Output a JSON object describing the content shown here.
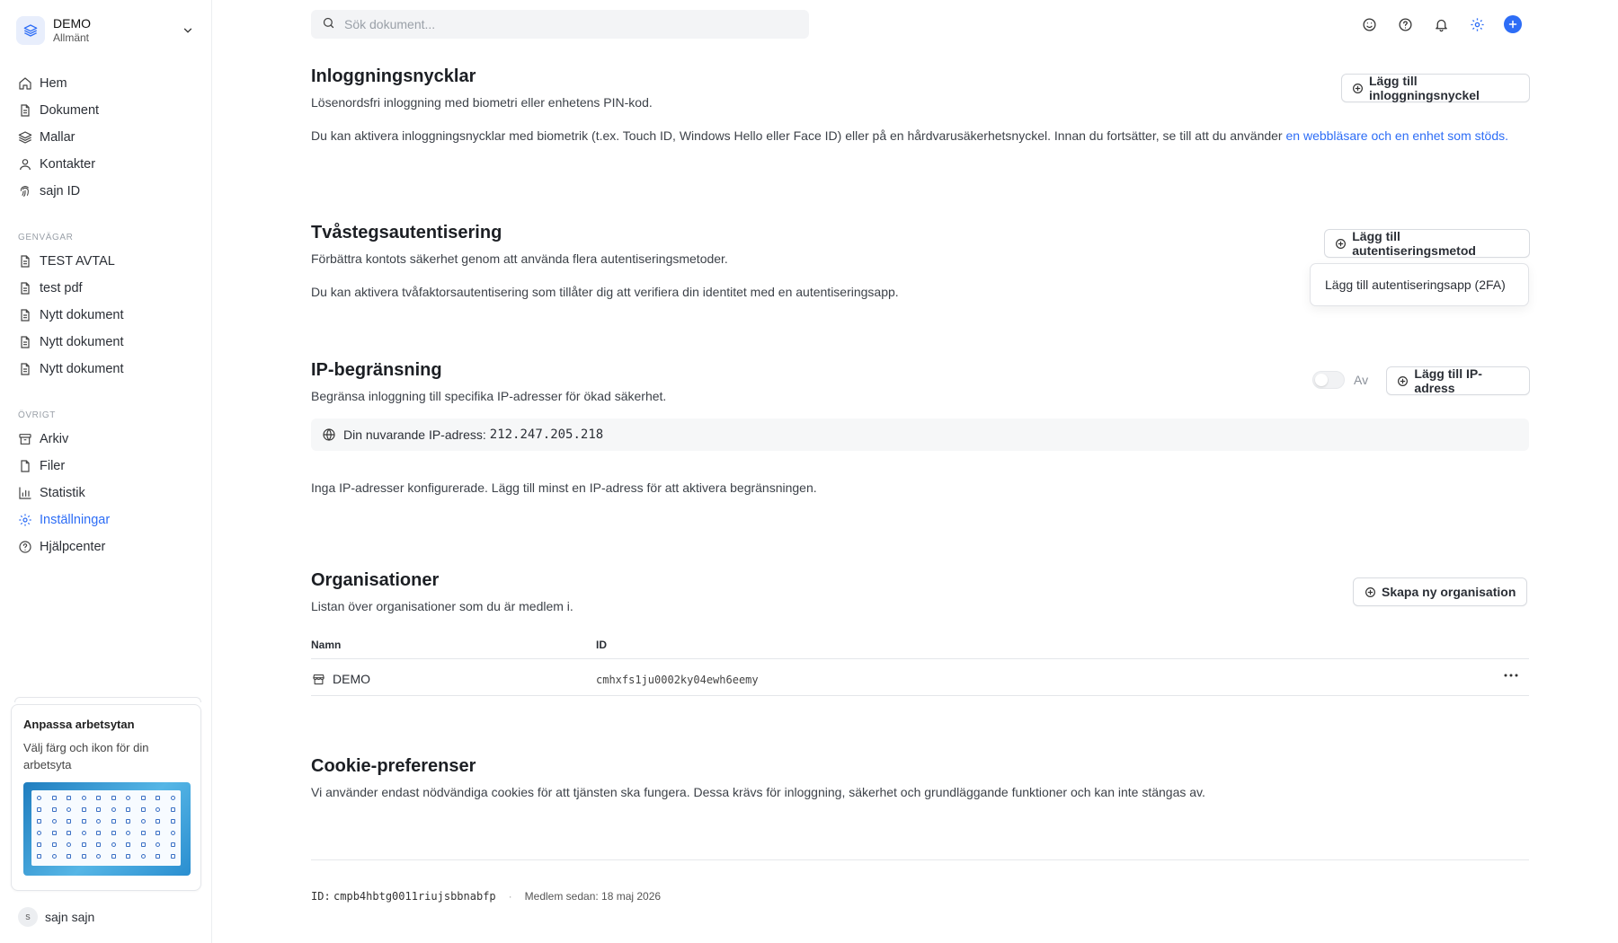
{
  "workspace": {
    "name": "DEMO",
    "subtitle": "Allmänt"
  },
  "nav_main": [
    {
      "label": "Hem",
      "icon": "home-icon"
    },
    {
      "label": "Dokument",
      "icon": "document-icon"
    },
    {
      "label": "Mallar",
      "icon": "layers-icon"
    },
    {
      "label": "Kontakter",
      "icon": "user-icon"
    },
    {
      "label": "sajn ID",
      "icon": "fingerprint-icon"
    }
  ],
  "shortcuts": {
    "heading": "GENVÄGAR",
    "items": [
      {
        "label": "TEST AVTAL"
      },
      {
        "label": "test pdf"
      },
      {
        "label": "Nytt dokument"
      },
      {
        "label": "Nytt dokument"
      },
      {
        "label": "Nytt dokument"
      }
    ]
  },
  "other": {
    "heading": "ÖVRIGT",
    "items": [
      {
        "label": "Arkiv",
        "icon": "archive-icon"
      },
      {
        "label": "Filer",
        "icon": "file-icon"
      },
      {
        "label": "Statistik",
        "icon": "chart-icon"
      },
      {
        "label": "Inställningar",
        "icon": "gear-icon",
        "active": true
      },
      {
        "label": "Hjälpcenter",
        "icon": "help-icon"
      }
    ]
  },
  "promo": {
    "title": "Anpassa arbetsytan",
    "description": "Välj färg och ikon för din arbetsyta"
  },
  "user": {
    "initial": "s",
    "name": "sajn sajn"
  },
  "search": {
    "placeholder": "Sök dokument..."
  },
  "colors": {
    "accent": "#2d6df6",
    "text": "#1f2328",
    "muted": "#3d4249"
  },
  "passkeys": {
    "title": "Inloggningsnycklar",
    "subtitle": "Lösenordsfri inloggning med biometri eller enhetens PIN-kod.",
    "body": "Du kan aktivera inloggningsnycklar med biometrik (t.ex. Touch ID, Windows Hello eller Face ID) eller på en hårdvarusäkerhetsnyckel. Innan du fortsätter, se till att du använder ",
    "link": "en webbläsare och en enhet som stöds.",
    "button": "Lägg till inloggningsnyckel"
  },
  "twofa": {
    "title": "Tvåstegsautentisering",
    "subtitle": "Förbättra kontots säkerhet genom att använda flera autentiseringsmetoder.",
    "body": "Du kan aktivera tvåfaktorsautentisering som tillåter dig att verifiera din identitet med en autentiseringsapp.",
    "button": "Lägg till autentiseringsmetod",
    "dropdown_item": "Lägg till autentiseringsapp (2FA)"
  },
  "ip": {
    "title": "IP-begränsning",
    "subtitle": "Begränsa inloggning till specifika IP-adresser för ökad säkerhet.",
    "toggle_label": "Av",
    "toggle_on": false,
    "button": "Lägg till IP-adress",
    "current_label": "Din nuvarande IP-adress:",
    "current_value": "212.247.205.218",
    "empty": "Inga IP-adresser konfigurerade. Lägg till minst en IP-adress för att aktivera begränsningen."
  },
  "orgs": {
    "title": "Organisationer",
    "subtitle": "Listan över organisationer som du är medlem i.",
    "button": "Skapa ny organisation",
    "columns": [
      "Namn",
      "ID"
    ],
    "rows": [
      {
        "name": "DEMO",
        "id": "cmhxfs1ju0002ky04ewh6eemy"
      }
    ]
  },
  "cookies": {
    "title": "Cookie-preferenser",
    "body": "Vi använder endast nödvändiga cookies för att tjänsten ska fungera. Dessa krävs för inloggning, säkerhet och grundläggande funktioner och kan inte stängas av."
  },
  "footer": {
    "id_label": "ID:",
    "id_value": "cmpb4hbtg0011riujsbbnabfp",
    "separator": "·",
    "member_since": "Medlem sedan: 18 maj 2026"
  }
}
